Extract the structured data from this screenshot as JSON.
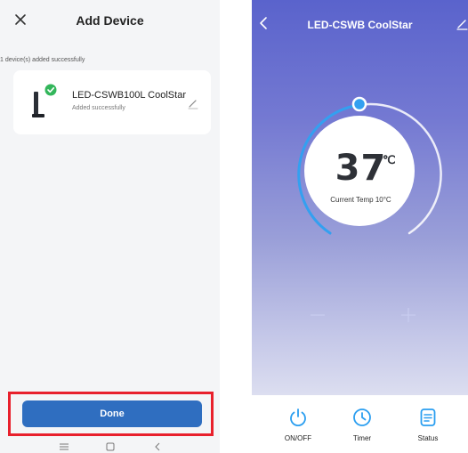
{
  "add_device": {
    "title": "Add Device",
    "success_note": "1 device(s) added successfully",
    "device": {
      "name": "LED-CSWB100L CoolStar",
      "status": "Added successfully"
    },
    "done_label": "Done"
  },
  "thermostat": {
    "title": "LED-CSWB CoolStar",
    "set_temp": "37",
    "unit": "℃",
    "current_temp": "Current Temp 10°C",
    "minus_label": "−",
    "plus_label": "+",
    "controls": [
      {
        "label": "ON/OFF",
        "icon": "power-icon"
      },
      {
        "label": "Timer",
        "icon": "clock-icon"
      },
      {
        "label": "Status",
        "icon": "document-icon"
      }
    ]
  },
  "colors": {
    "accent": "#2f6ec0",
    "highlight_frame": "#e8202c",
    "gradient_top": "#5a63cc",
    "dial_arc": "#33a0f0",
    "control_icon": "#2a9ef0"
  }
}
